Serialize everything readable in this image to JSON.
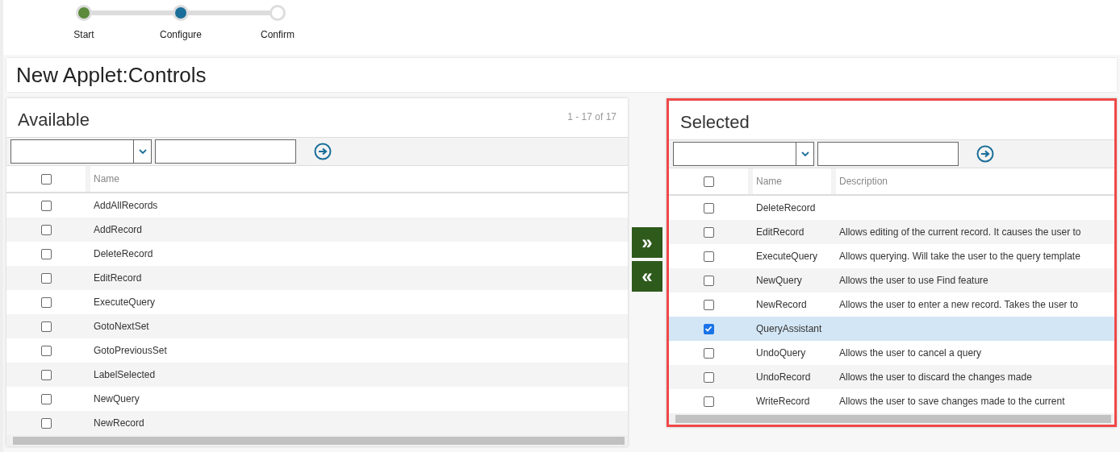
{
  "stepper": {
    "steps": [
      {
        "label": "Start",
        "completed": true,
        "selected": false
      },
      {
        "label": "Configure",
        "completed": false,
        "selected": true
      },
      {
        "label": "Confirm",
        "completed": false,
        "selected": false
      }
    ]
  },
  "title": "New Applet:Controls",
  "available": {
    "title": "Available",
    "count": "1 - 17 of 17",
    "columns": [
      "Name"
    ],
    "select_all": false,
    "rows": [
      {
        "name": "AddAllRecords",
        "checked": false
      },
      {
        "name": "AddRecord",
        "checked": false
      },
      {
        "name": "DeleteRecord",
        "checked": false
      },
      {
        "name": "EditRecord",
        "checked": false
      },
      {
        "name": "ExecuteQuery",
        "checked": false
      },
      {
        "name": "GotoNextSet",
        "checked": false
      },
      {
        "name": "GotoPreviousSet",
        "checked": false
      },
      {
        "name": "LabelSelected",
        "checked": false
      },
      {
        "name": "NewQuery",
        "checked": false
      },
      {
        "name": "NewRecord",
        "checked": false
      }
    ]
  },
  "move_buttons": [
    {
      "symbol": "»"
    },
    {
      "symbol": "«"
    }
  ],
  "selected": {
    "title": "Selected",
    "highlighted": true,
    "columns": [
      "Name",
      "Description"
    ],
    "select_all": false,
    "rows": [
      {
        "name": "DeleteRecord",
        "description": "",
        "checked": false
      },
      {
        "name": "EditRecord",
        "description": "Allows editing of the current record. It causes the user to",
        "checked": false
      },
      {
        "name": "ExecuteQuery",
        "description": "Allows querying. Will take the user to the query template",
        "checked": false
      },
      {
        "name": "NewQuery",
        "description": "Allows the user to use Find feature",
        "checked": false
      },
      {
        "name": "NewRecord",
        "description": "Allows the user to enter a new record. Takes the user to",
        "checked": false
      },
      {
        "name": "QueryAssistant",
        "description": "",
        "checked": true
      },
      {
        "name": "UndoQuery",
        "description": "Allows the user to cancel a query",
        "checked": false
      },
      {
        "name": "UndoRecord",
        "description": "Allows the user to discard the changes made",
        "checked": false
      },
      {
        "name": "WriteRecord",
        "description": "Allows the user to save changes made to the current",
        "checked": false
      }
    ]
  }
}
